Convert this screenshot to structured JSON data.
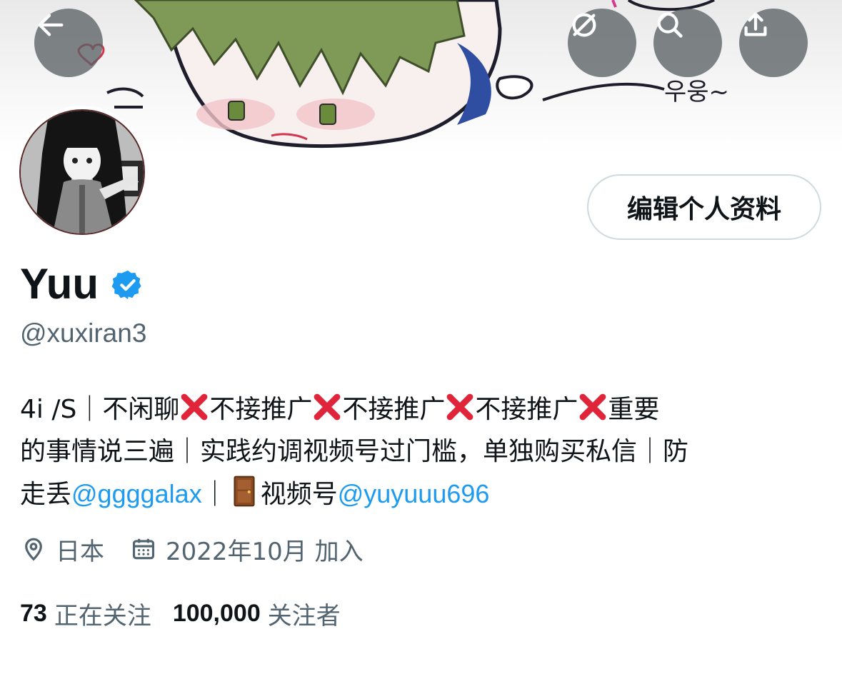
{
  "profile": {
    "display_name": "Yuu",
    "handle": "@xuxiran3",
    "edit_button": "编辑个人资料",
    "bio": {
      "line1": {
        "prefix": "4i /S｜不闲聊",
        "p1": "不接推广",
        "p2": "不接推广",
        "p3": "不接推广",
        "suffix": "重要"
      },
      "line2": "的事情说三遍｜实践约调视频号过门槛，单独购买私信｜防",
      "line3": {
        "prefix": "走丢",
        "mention1": "@ggggalax",
        "sep": "｜",
        "text": "视频号",
        "mention2": "@yuyuuu696"
      }
    },
    "location": "日本",
    "joined": "2022年10月 加入",
    "following_count": "73",
    "following_label": "正在关注",
    "followers_count": "100,000",
    "followers_label": "关注者"
  },
  "icons": {
    "back": "arrow-left-icon",
    "hide": "hide-icon",
    "search": "search-icon",
    "share": "share-icon",
    "verified": "verified-badge-icon",
    "location": "location-pin-icon",
    "calendar": "calendar-icon",
    "xmark": "cross-mark-emoji",
    "door": "door-emoji"
  },
  "colors": {
    "accent": "#1d9bf0",
    "secondary_text": "#536471",
    "border": "#cfd9de",
    "verified": "#1d9bf0",
    "xmark": "#e0243a"
  }
}
